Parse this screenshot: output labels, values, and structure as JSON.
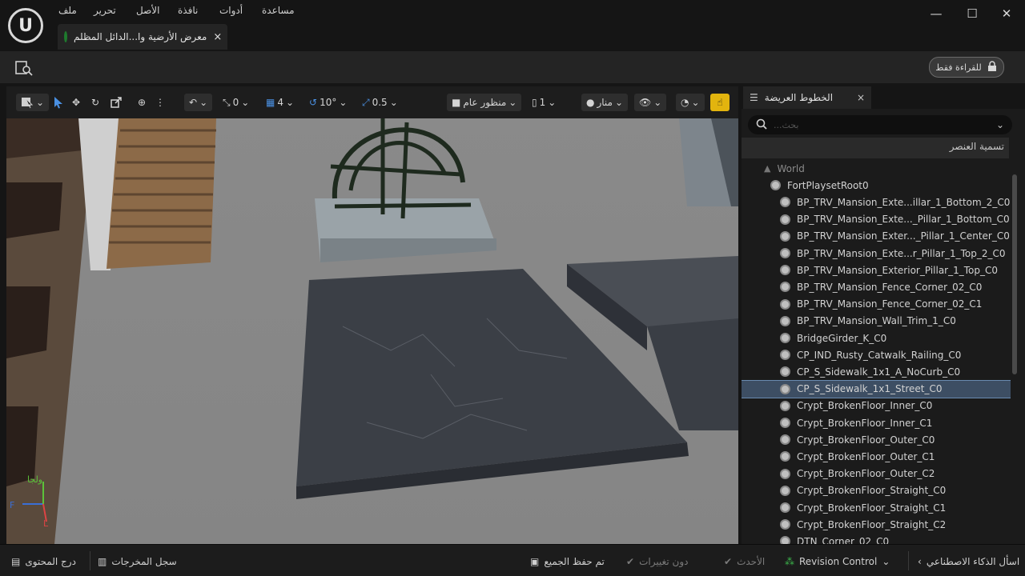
{
  "titlebar": {
    "menu": [
      "ملف",
      "تحرير",
      "الأصل",
      "نافذة",
      "أدوات",
      "مساعدة"
    ],
    "tab_label": "معرض الأرضية وا...الدائل المظلم",
    "close_glyph": "×",
    "window_controls": [
      "—",
      "☐",
      "✕"
    ]
  },
  "toolbar": {
    "readonly_label": "للقراءة فقط"
  },
  "viewport_toolbar": {
    "grid_snap": "0",
    "grid_size": "4",
    "rot_snap": "10°",
    "scale_snap": "0.5",
    "perspective": "منظور عام",
    "camera_speed": "1",
    "lit_mode": "منار"
  },
  "axis": {
    "label": "ولجا",
    "x": "F",
    "z": "L"
  },
  "outliner": {
    "tab_label": "الخطوط العريضة",
    "close_glyph": "×",
    "search_placeholder": "بحث...",
    "column_header": "تسمية العنصر",
    "items": [
      {
        "label": "World",
        "depth": 0,
        "dim": true
      },
      {
        "label": "FortPlaysetRoot0",
        "depth": 1
      },
      {
        "label": "BP_TRV_Mansion_Exte...illar_1_Bottom_2_C0",
        "depth": 2
      },
      {
        "label": "BP_TRV_Mansion_Exte..._Pillar_1_Bottom_C0",
        "depth": 2
      },
      {
        "label": "BP_TRV_Mansion_Exter..._Pillar_1_Center_C0",
        "depth": 2
      },
      {
        "label": "BP_TRV_Mansion_Exte...r_Pillar_1_Top_2_C0",
        "depth": 2
      },
      {
        "label": "BP_TRV_Mansion_Exterior_Pillar_1_Top_C0",
        "depth": 2
      },
      {
        "label": "BP_TRV_Mansion_Fence_Corner_02_C0",
        "depth": 2
      },
      {
        "label": "BP_TRV_Mansion_Fence_Corner_02_C1",
        "depth": 2
      },
      {
        "label": "BP_TRV_Mansion_Wall_Trim_1_C0",
        "depth": 2
      },
      {
        "label": "BridgeGirder_K_C0",
        "depth": 2
      },
      {
        "label": "CP_IND_Rusty_Catwalk_Railing_C0",
        "depth": 2
      },
      {
        "label": "CP_S_Sidewalk_1x1_A_NoCurb_C0",
        "depth": 2
      },
      {
        "label": "CP_S_Sidewalk_1x1_Street_C0",
        "depth": 2,
        "selected": true
      },
      {
        "label": "Crypt_BrokenFloor_Inner_C0",
        "depth": 2
      },
      {
        "label": "Crypt_BrokenFloor_Inner_C1",
        "depth": 2
      },
      {
        "label": "Crypt_BrokenFloor_Outer_C0",
        "depth": 2
      },
      {
        "label": "Crypt_BrokenFloor_Outer_C1",
        "depth": 2
      },
      {
        "label": "Crypt_BrokenFloor_Outer_C2",
        "depth": 2
      },
      {
        "label": "Crypt_BrokenFloor_Straight_C0",
        "depth": 2
      },
      {
        "label": "Crypt_BrokenFloor_Straight_C1",
        "depth": 2
      },
      {
        "label": "Crypt_BrokenFloor_Straight_C2",
        "depth": 2
      },
      {
        "label": "DTN_Corner_02_C0",
        "depth": 2
      }
    ]
  },
  "statusbar": {
    "content_drawer": "درج المحتوى",
    "output_log": "سجل المخرجات",
    "save_all": "تم حفظ الجميع",
    "no_changes": "دون تغييرات",
    "latest": "الأحدث",
    "revision_control": "Revision Control",
    "ai_assistant": "اسأل الذكاء الاصطناعي"
  },
  "colors": {
    "accent_yellow": "#e2b40e",
    "selection": "#3d4e63",
    "status_green": "#3cb44b"
  }
}
